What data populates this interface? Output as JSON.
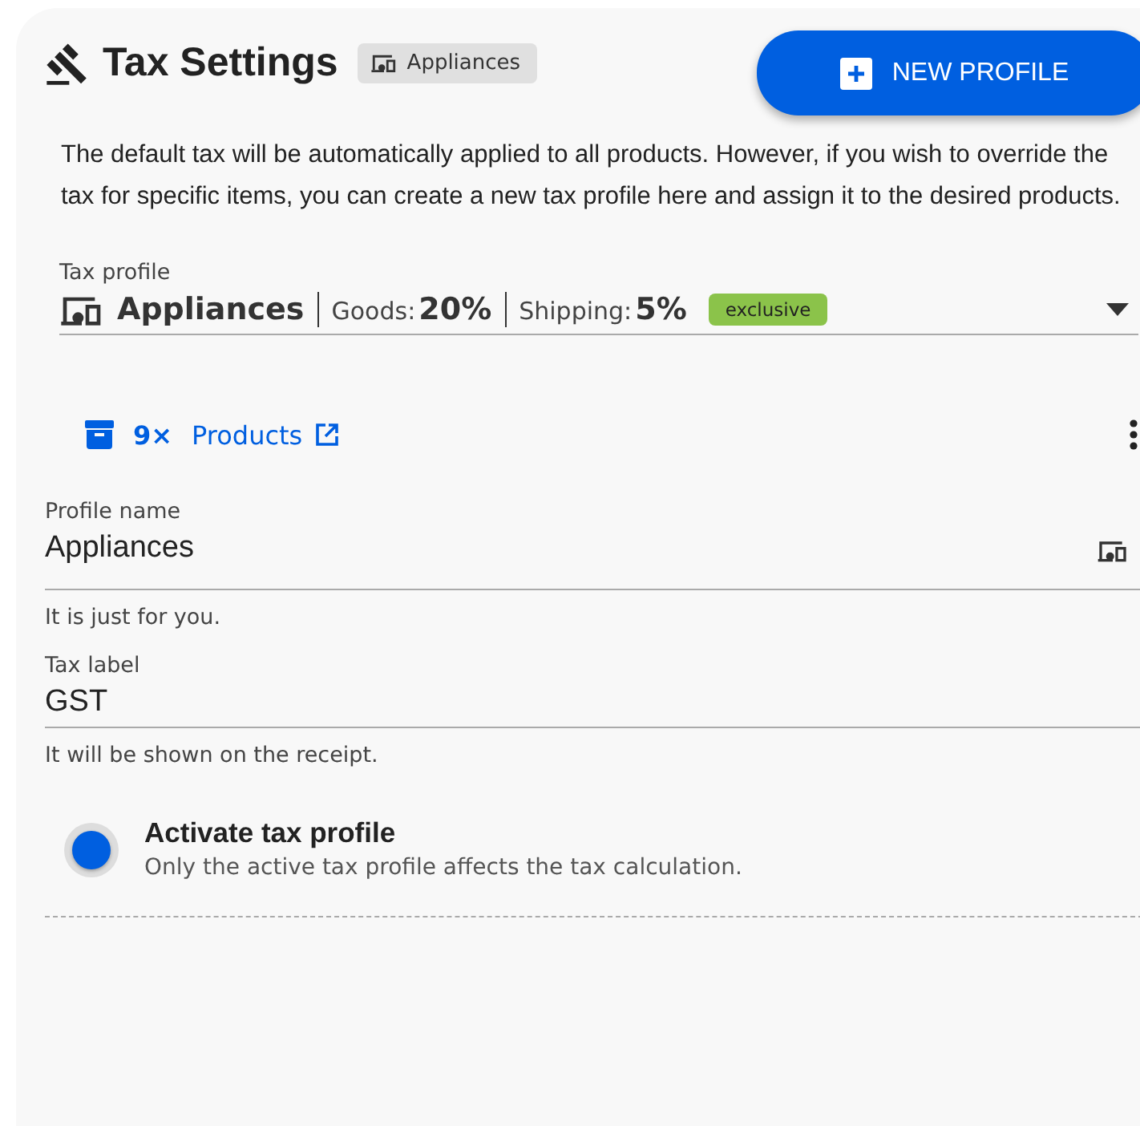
{
  "header": {
    "title": "Tax Settings",
    "chip": "Appliances",
    "new_button": "NEW PROFILE"
  },
  "description": "The default tax will be automatically applied to all products. However, if you wish to override the tax for specific items, you can create a new tax profile here and assign it to the desired products.",
  "tax_profile": {
    "label": "Tax profile",
    "name": "Appliances",
    "goods_label": "Goods:",
    "goods_value": "20%",
    "shipping_label": "Shipping:",
    "shipping_value": "5%",
    "badge": "exclusive"
  },
  "products": {
    "count": "9×",
    "link": "Products"
  },
  "fields": [
    {
      "label": "Profile name",
      "value": "Appliances",
      "helper": "It is just for you.",
      "kind": "icon"
    },
    {
      "label": "Tax label",
      "value": "GST",
      "helper": "It will be shown on the receipt.",
      "kind": "plain"
    }
  ],
  "activate": {
    "title": "Activate tax profile",
    "subtitle": "Only the active tax profile affects the tax calculation.",
    "on": true
  }
}
